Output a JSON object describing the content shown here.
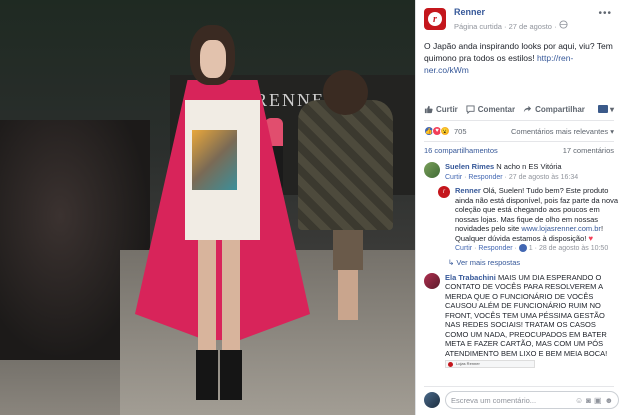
{
  "photo": {
    "brand_sign": "RENNER"
  },
  "post": {
    "page_name": "Renner",
    "meta": "Página curtida · 27 de agosto · ",
    "text": "O Japão anda inspirando looks por aqui, viu? Tem quimono pra todos os estilos!",
    "link": "http://ren-ner.co/kWm",
    "actions": {
      "like": "Curtir",
      "comment": "Comentar",
      "share": "Compartilhar"
    },
    "reactions_count": "705",
    "relevance": "Comentários mais relevantes",
    "shares": "16 compartilhamentos",
    "comments_count": "17 comentários"
  },
  "comments": [
    {
      "author": "Suelen Rimes",
      "text": "N acho n ES Vitória",
      "meta_like": "Curtir",
      "meta_reply": "Responder",
      "meta_time": "27 de agosto às 16:34"
    },
    {
      "author": "Renner",
      "text": "Olá, Suelen! Tudo bem? Este produto ainda não está disponível, pois faz parte da nova coleção que está chegando aos poucos em nossas lojas. Mas fique de olho em nossas novidades pelo site",
      "link": "www.lojasrenner.com.br",
      "text2": "! Qualquer dúvida estamos à disposição!",
      "meta_like": "Curtir",
      "meta_reply": "Responder",
      "meta_likes": "1",
      "meta_time": "28 de agosto às 10:50"
    },
    {
      "more": "Ver mais respostas"
    },
    {
      "author": "Ela Trabachini",
      "text": "MAIS UM DIA ESPERANDO O CONTATO DE VOCÊS PARA RESOLVEREM A MERDA QUE O FUNCIONÁRIO DE VOCÊS CAUSOU ALÉM DE FUNCIONÁRIO RUIM NO FRONT, VOCÊS TEM UMA PÉSSIMA GESTÃO NAS REDES SOCIAIS! TRATAM OS CASOS COMO UM NADA, PREOCUPADOS EM BATER META E FAZER CARTÃO, MAS COM UM PÓS ATENDIMENTO BEM LIXO E BEM MEIA BOCA!",
      "thumb_label": "Lojas Renner"
    }
  ],
  "composer": {
    "placeholder": "Escreva um comentário..."
  },
  "colors": {
    "brand_red": "#c4161c",
    "link_blue": "#365899",
    "muted": "#90949c"
  }
}
